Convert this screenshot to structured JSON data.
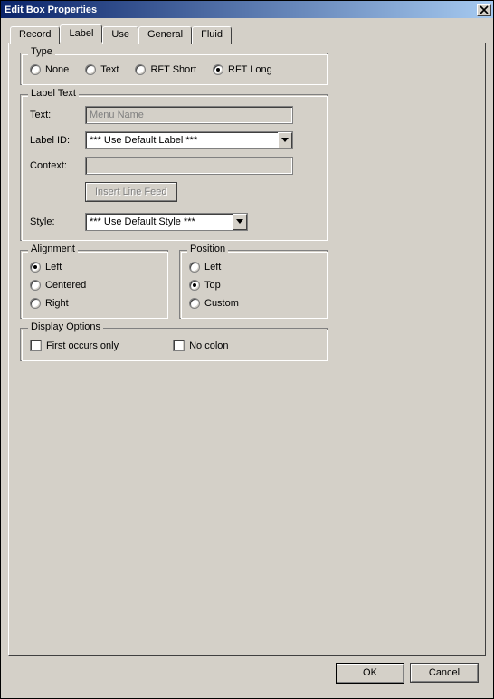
{
  "window": {
    "title": "Edit Box Properties"
  },
  "tabs": {
    "record": "Record",
    "label": "Label",
    "use": "Use",
    "general": "General",
    "fluid": "Fluid",
    "active": "label"
  },
  "type_group": {
    "legend": "Type",
    "options": {
      "none": "None",
      "text": "Text",
      "rft_short": "RFT Short",
      "rft_long": "RFT Long"
    },
    "selected": "rft_long"
  },
  "label_text_group": {
    "legend": "Label Text",
    "text_label": "Text:",
    "text_value": "Menu Name",
    "labelid_label": "Label ID:",
    "labelid_value": "*** Use Default Label ***",
    "context_label": "Context:",
    "context_value": "",
    "insert_btn": "Insert Line Feed",
    "style_label": "Style:",
    "style_value": "*** Use Default Style ***"
  },
  "alignment_group": {
    "legend": "Alignment",
    "left": "Left",
    "centered": "Centered",
    "right": "Right",
    "selected": "left"
  },
  "position_group": {
    "legend": "Position",
    "left": "Left",
    "top": "Top",
    "custom": "Custom",
    "selected": "top"
  },
  "display_options_group": {
    "legend": "Display Options",
    "first_occurs": "First occurs only",
    "no_colon": "No colon"
  },
  "buttons": {
    "ok": "OK",
    "cancel": "Cancel"
  }
}
